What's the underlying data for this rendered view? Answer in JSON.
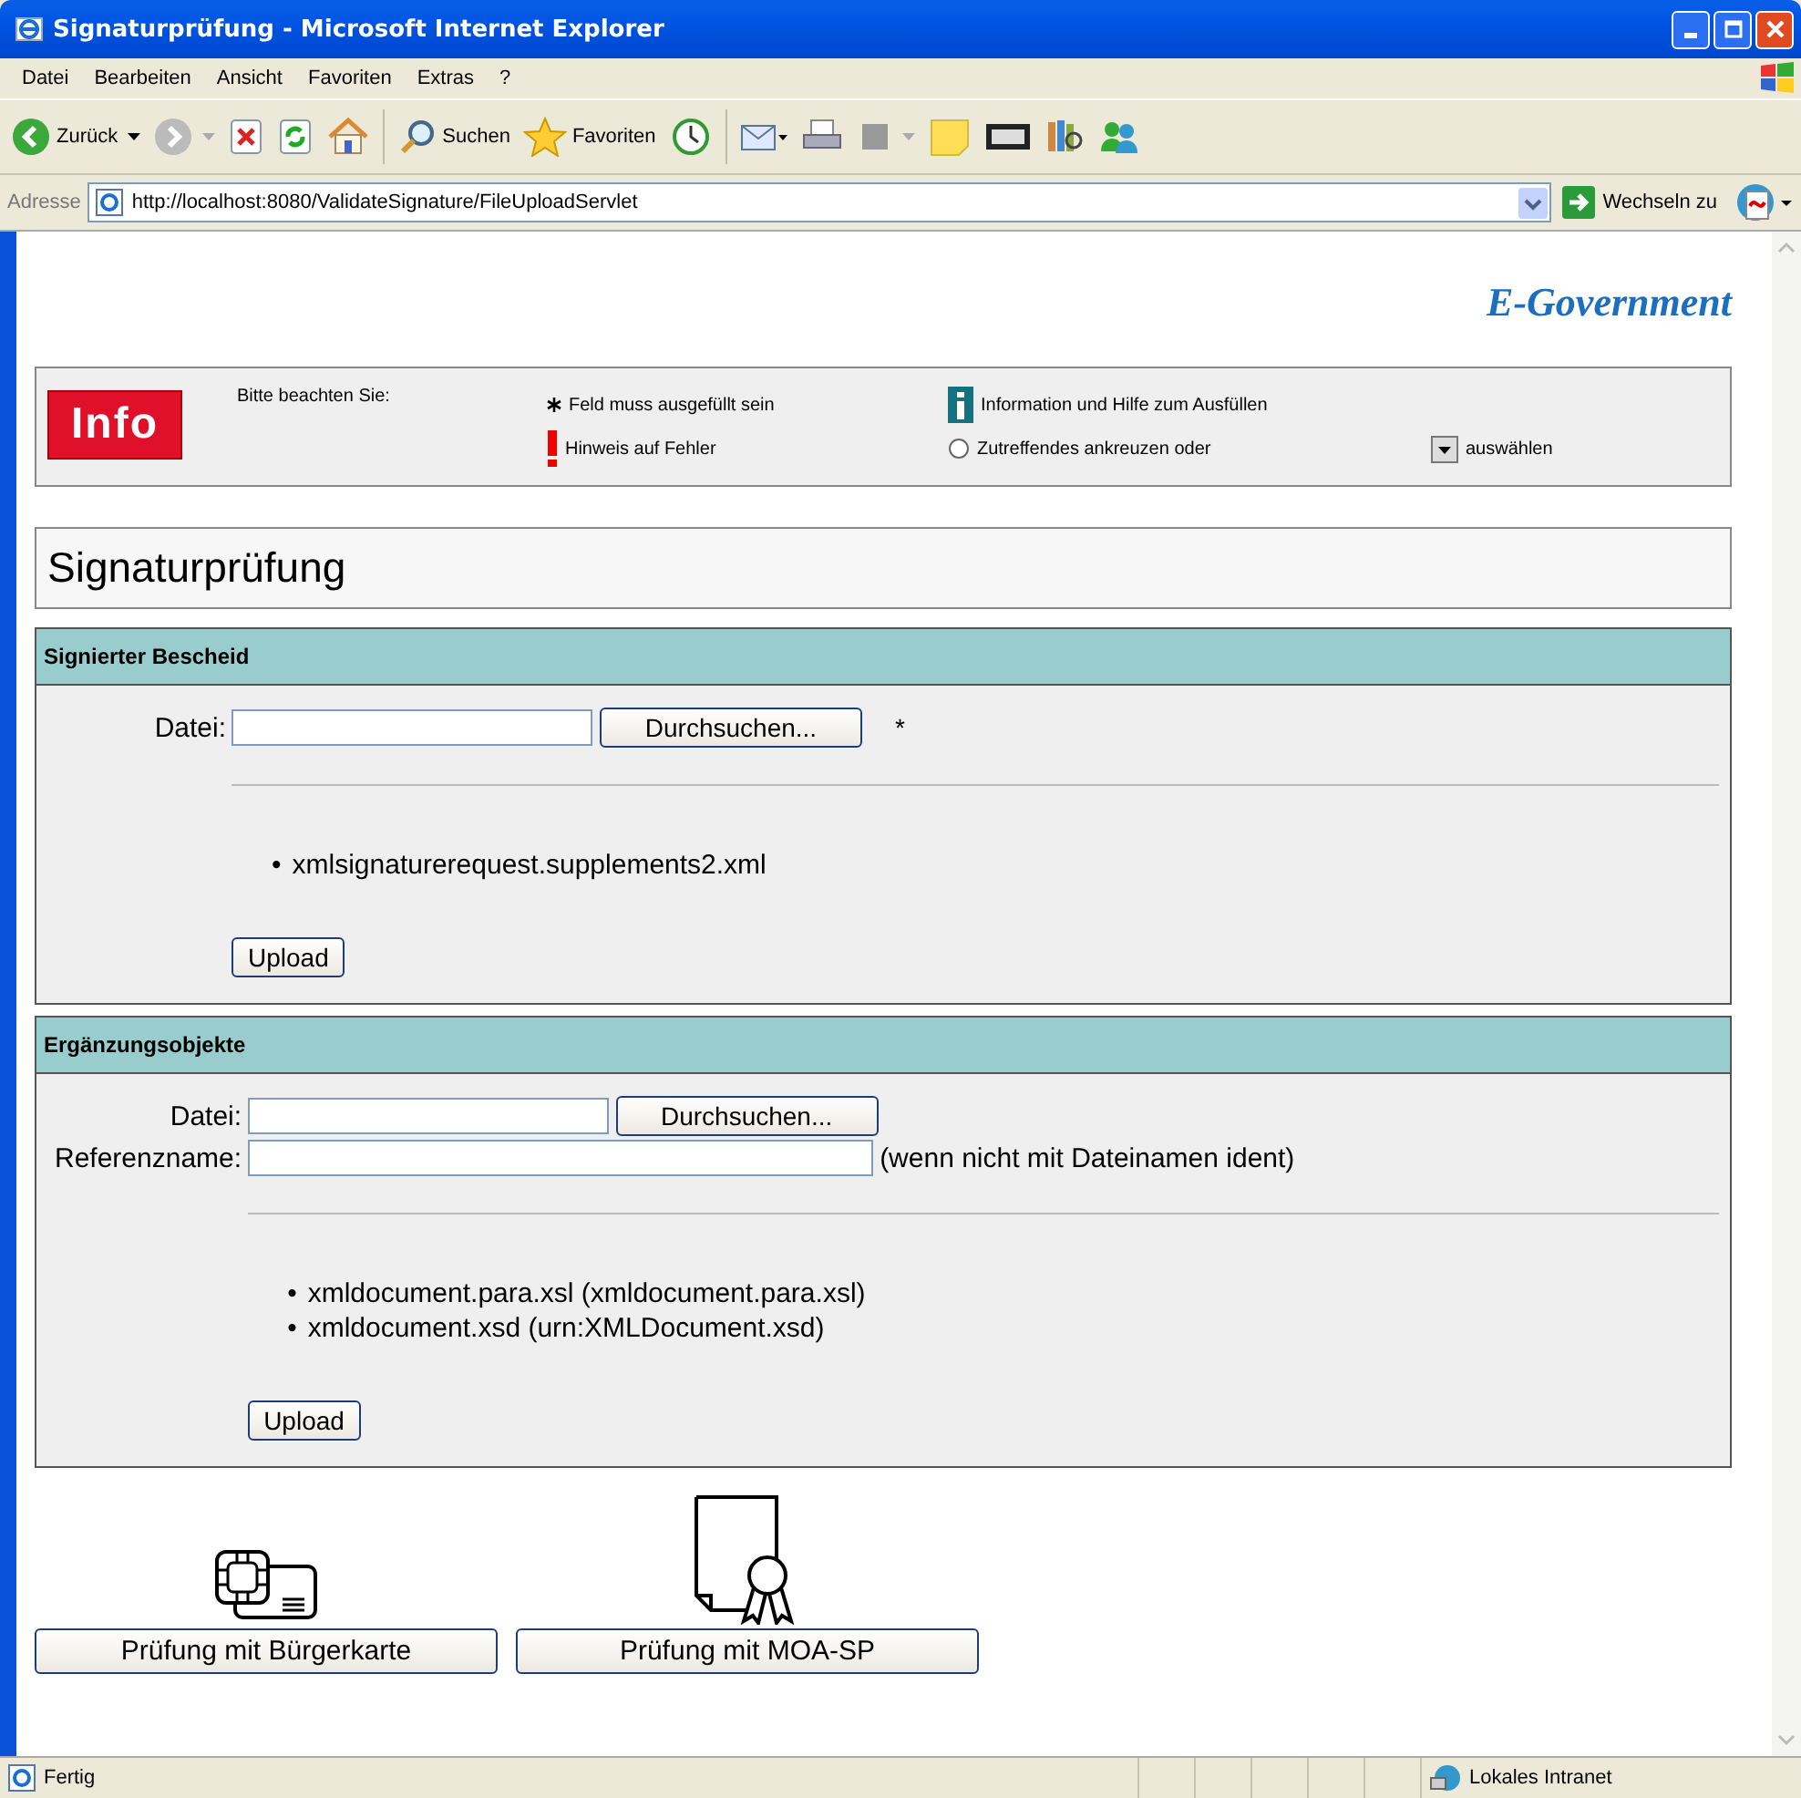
{
  "window": {
    "title": "Signaturprüfung - Microsoft Internet Explorer"
  },
  "menu": [
    "Datei",
    "Bearbeiten",
    "Ansicht",
    "Favoriten",
    "Extras",
    "?"
  ],
  "toolbar": {
    "back": "Zurück",
    "search": "Suchen",
    "favorites": "Favoriten"
  },
  "address": {
    "label": "Adresse",
    "url": "http://localhost:8080/ValidateSignature/FileUploadServlet",
    "go": "Wechseln zu"
  },
  "brand": "E-Government",
  "info": {
    "badge": "Info",
    "intro": "Bitte beachten Sie:",
    "required": "Feld muss ausgefüllt sein",
    "help": "Information und Hilfe zum Ausfüllen",
    "error": "Hinweis auf Fehler",
    "radio": "Zutreffendes ankreuzen oder",
    "select": "auswählen"
  },
  "heading": "Signaturprüfung",
  "sections": [
    {
      "title": "Signierter Bescheid",
      "fields": [
        {
          "kind": "file",
          "label": "Datei:",
          "button": "Durchsuchen...",
          "required_mark": "*"
        }
      ],
      "files": [
        {
          "marker": "•",
          "name": "xmlsignaturerequest.supplements2.xml"
        }
      ],
      "upload": "Upload"
    },
    {
      "title": "Ergänzungsobjekte",
      "fields": [
        {
          "kind": "file",
          "label": "Datei:",
          "button": "Durchsuchen..."
        },
        {
          "kind": "text",
          "label": "Referenzname:",
          "note": "(wenn nicht mit Dateinamen ident)"
        }
      ],
      "files": [
        {
          "marker": "•",
          "name": "xmldocument.para.xsl (xmldocument.para.xsl)"
        },
        {
          "marker": "•",
          "name": "xmldocument.xsd (urn:XMLDocument.xsd)"
        }
      ],
      "upload": "Upload"
    }
  ],
  "actions": [
    {
      "kind": "card",
      "label": "Prüfung mit Bürgerkarte"
    },
    {
      "kind": "certificate",
      "label": "Prüfung mit MOA-SP"
    }
  ],
  "status_bar": {
    "text": "Fertig",
    "zone": "Lokales Intranet"
  }
}
